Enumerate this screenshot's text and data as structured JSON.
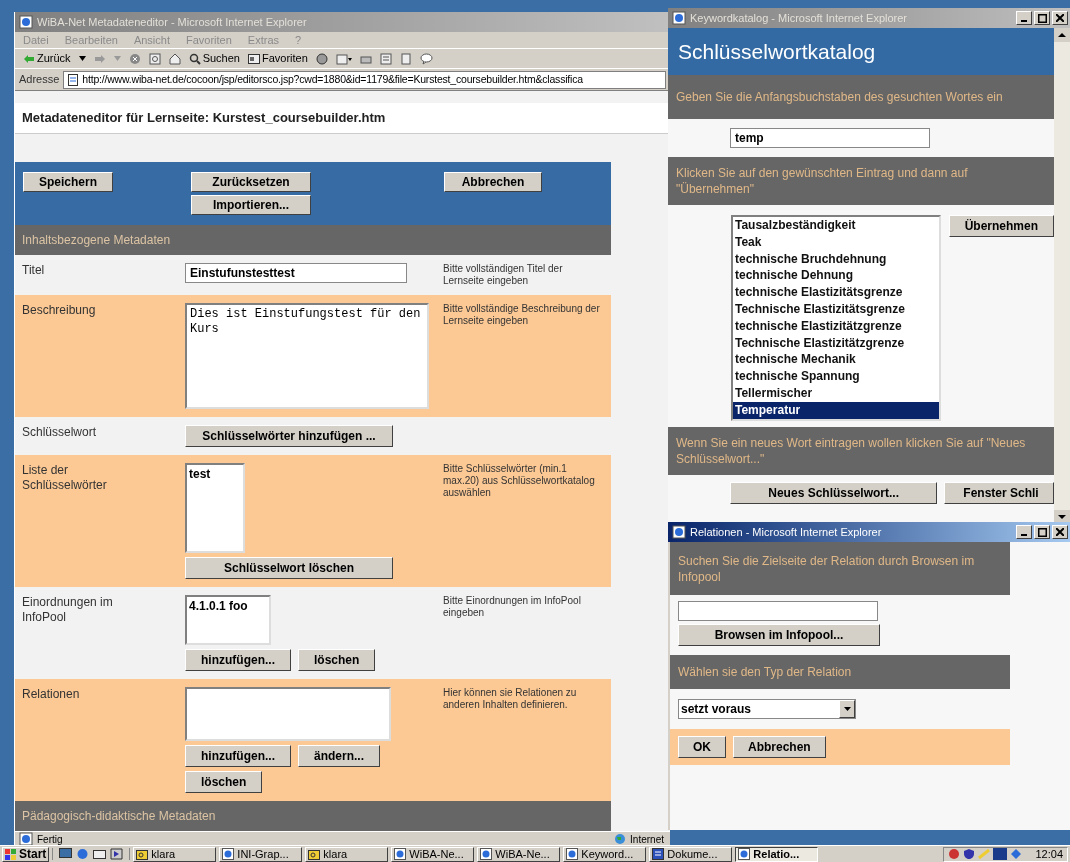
{
  "main_window": {
    "title": "WiBA-Net Metadateneditor - Microsoft Internet Explorer",
    "active": false,
    "menu": [
      "Datei",
      "Bearbeiten",
      "Ansicht",
      "Favoriten",
      "Extras",
      "?"
    ],
    "toolbar": [
      {
        "kind": "back",
        "label": "Zurück"
      },
      {
        "kind": "search",
        "label": "Suchen"
      },
      {
        "kind": "favorites",
        "label": "Favoriten"
      }
    ],
    "address_label": "Adresse",
    "address": "http://www.wiba-net.de/cocoon/jsp/editorsco.jsp?cwd=1880&id=1179&file=Kurstest_coursebuilder.htm&classifica",
    "page_title": "Metadateneditor für Lernseite: Kurstest_coursebuilder.htm",
    "action_buttons": [
      "Speichern",
      "Zurücksetzen",
      "Importieren...",
      "Abbrechen"
    ],
    "section": "Inhaltsbezogene Metadaten",
    "rows": [
      {
        "label": "Titel",
        "highlighted": false,
        "controls": [
          [
            {
              "kind": "input",
              "value": "Einstufunstesttest"
            }
          ]
        ],
        "hint": "Bitte vollständigen Titel der Lernseite eingeben"
      },
      {
        "label": "Beschreibung",
        "highlighted": true,
        "controls": [
          [
            {
              "kind": "textarea",
              "value": "Dies ist Einstufungstest für den Kurs"
            }
          ]
        ],
        "hint": "Bitte vollständige Beschreibung der Lernseite eingeben"
      },
      {
        "label": "Schlüsselwort",
        "highlighted": false,
        "controls": [
          [
            {
              "kind": "button",
              "label": "Schlüsselwörter hinzufügen ..."
            }
          ]
        ]
      },
      {
        "label": "Liste der Schlüsselwörter",
        "highlighted": true,
        "controls": [
          [
            {
              "kind": "listbox",
              "items": [
                "test"
              ]
            }
          ],
          [
            {
              "kind": "button",
              "label": "Schlüsselwort löschen"
            }
          ]
        ],
        "hint": "Bitte Schlüsselwörter (min.1 max.20) aus Schlüsselwortkatalog auswählen"
      },
      {
        "label": "Einordnungen im InfoPool",
        "highlighted": false,
        "controls": [
          [
            {
              "kind": "listbox",
              "items": [
                "4.1.0.1 foo"
              ]
            }
          ],
          [
            {
              "kind": "button",
              "label": "hinzufügen..."
            },
            {
              "kind": "button",
              "label": "löschen"
            }
          ]
        ],
        "hint": "Bitte Einordnungen im InfoPool eingeben"
      },
      {
        "label": "Relationen",
        "highlighted": true,
        "controls": [
          [
            {
              "kind": "listbox"
            }
          ],
          [
            {
              "kind": "button",
              "label": "hinzufügen..."
            },
            {
              "kind": "button",
              "label": "ändern..."
            }
          ],
          [
            {
              "kind": "button",
              "label": "löschen"
            }
          ]
        ],
        "hint": "Hier können sie Relationen zu anderen Inhalten definieren."
      }
    ],
    "next_section": "Pädagogisch-didaktische Metadaten",
    "status": "Fertig",
    "zone": "Internet"
  },
  "keyword_window": {
    "title": "Keywordkatalog - Microsoft Internet Explorer",
    "active": false,
    "heading": "Schlüsselwortkatalog",
    "prompt": "Geben Sie die Anfangsbuchstaben des gesuchten Wortes ein",
    "search_value": "temp",
    "instruction": "Klicken Sie auf den gewünschten Eintrag und dann auf \"Übernehmen\"",
    "items": [
      {
        "label": "Tausalzbeständigkeit",
        "selected": false
      },
      {
        "label": "Teak",
        "selected": false
      },
      {
        "label": "technische Bruchdehnung",
        "selected": false
      },
      {
        "label": "technische Dehnung",
        "selected": false
      },
      {
        "label": "technische Elastizitätsgrenze",
        "selected": false
      },
      {
        "label": "Technische Elastizitätsgrenze",
        "selected": false
      },
      {
        "label": "technische Elastizitätzgrenze",
        "selected": false
      },
      {
        "label": "Technische Elastizitätzgrenze",
        "selected": false
      },
      {
        "label": "technische Mechanik",
        "selected": false
      },
      {
        "label": "technische Spannung",
        "selected": false
      },
      {
        "label": "Tellermischer",
        "selected": false
      },
      {
        "label": "Temperatur",
        "selected": true
      }
    ],
    "apply_button": "Übernehmen",
    "new_hint": "Wenn Sie ein neues Wort eintragen wollen klicken Sie auf \"Neues Schlüsselwort...\"",
    "buttons": [
      "Neues Schlüsselwort...",
      "Fenster Schli"
    ]
  },
  "relations_window": {
    "title": "Relationen - Microsoft Internet Explorer",
    "active": true,
    "prompt": "Suchen Sie die Zielseite der Relation durch Browsen im Infopool",
    "browse_button": "Browsen im Infopool...",
    "type_prompt": "Wählen sie den Typ der Relation",
    "type_value": "setzt voraus",
    "buttons": [
      "OK",
      "Abbrechen"
    ]
  },
  "taskbar": {
    "start": "Start",
    "tasks": [
      {
        "label": "klara",
        "kind": "folder",
        "selected": false
      },
      {
        "label": "INI-Grap...",
        "kind": "ie",
        "selected": false
      },
      {
        "label": "klara",
        "kind": "folder",
        "selected": false
      },
      {
        "label": "WiBA-Ne...",
        "kind": "ie",
        "selected": false
      },
      {
        "label": "WiBA-Ne...",
        "kind": "ie",
        "selected": false
      },
      {
        "label": "Keyword...",
        "kind": "ie",
        "selected": false
      },
      {
        "label": "Dokume...",
        "kind": "word",
        "selected": false
      },
      {
        "label": "Relatio...",
        "kind": "ie",
        "selected": true
      }
    ],
    "clock": "12:04"
  }
}
